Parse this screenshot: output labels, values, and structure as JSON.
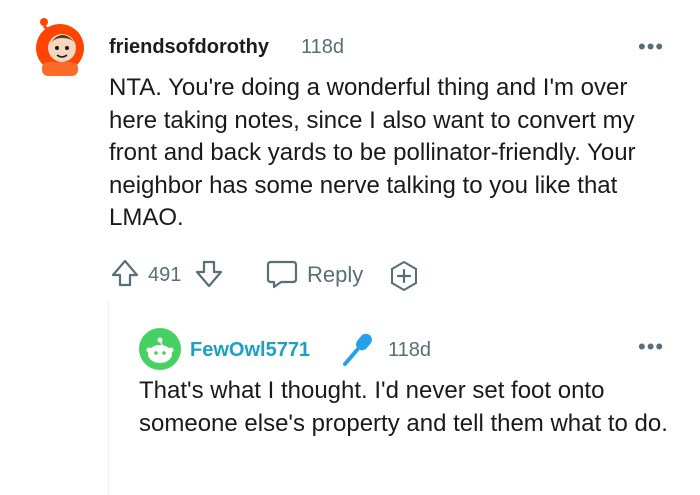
{
  "comment": {
    "username": "friendsofdorothy",
    "time": "118d",
    "more": "•••",
    "body": "NTA. You're doing a wonderful thing and I'm over here taking notes, since I also want to convert my front and back yards to be pollinator-friendly. Your neighbor has some nerve talking to you like that LMAO.",
    "score": "491",
    "reply_label": "Reply"
  },
  "reply": {
    "username": "FewOwl5771",
    "time": "118d",
    "more": "•••",
    "body": "That's what I thought. I'd never set foot onto someone else's property and tell them what to do."
  },
  "colors": {
    "meta": "#576f76",
    "reply_username": "#1ca0c4",
    "avatar_green": "#46d160",
    "avatar_orange": "#ff4500",
    "mic_blue": "#24a0ed"
  },
  "icons": [
    "avatar-snoo-icon",
    "upvote-arrow-icon",
    "downvote-arrow-icon",
    "reply-bubble-icon",
    "award-plus-icon",
    "microphone-icon"
  ]
}
